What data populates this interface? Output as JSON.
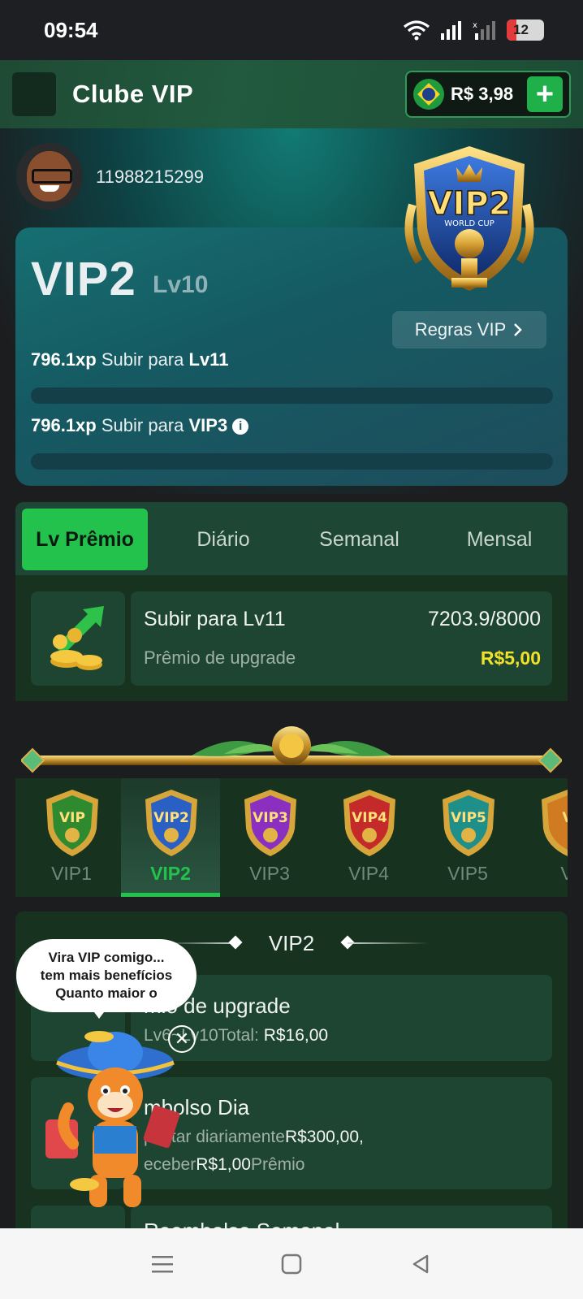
{
  "status": {
    "time": "09:54",
    "battery_level": "12"
  },
  "header": {
    "title": "Clube VIP",
    "balance": "R$ 3,98",
    "add_label": "+"
  },
  "user": {
    "id": "11988215299"
  },
  "vip_card": {
    "level": "VIP2",
    "sub_level": "Lv10",
    "badge_text": "VIP2",
    "badge_subtext": "WORLD CUP",
    "rules_label": "Regras VIP",
    "xp_lv_value": "796.1xp",
    "xp_lv_text": "Subir para",
    "xp_lv_target": "Lv11",
    "xp_vip_value": "796.1xp",
    "xp_vip_text": "Subir para",
    "xp_vip_target": "VIP3",
    "progress_lv": 0,
    "progress_vip": 0
  },
  "tabs": [
    {
      "label": "Lv Prêmio",
      "active": true
    },
    {
      "label": "Diário",
      "active": false
    },
    {
      "label": "Semanal",
      "active": false
    },
    {
      "label": "Mensal",
      "active": false
    }
  ],
  "level_reward": {
    "title": "Subir para Lv11",
    "progress": "7203.9/8000",
    "subtitle": "Prêmio de upgrade",
    "value": "R$5,00"
  },
  "levels": [
    {
      "label": "VIP1",
      "badge": "VIP",
      "color": "#2f8a2f"
    },
    {
      "label": "VIP2",
      "badge": "VIP2",
      "color": "#2a5fc4",
      "active": true
    },
    {
      "label": "VIP3",
      "badge": "VIP3",
      "color": "#8a2fc0"
    },
    {
      "label": "VIP4",
      "badge": "VIP4",
      "color": "#c42a2a"
    },
    {
      "label": "VIP5",
      "badge": "VIP5",
      "color": "#1f8f8a"
    },
    {
      "label": "V",
      "badge": "V",
      "color": "#d07a22"
    }
  ],
  "benefits": {
    "title": "VIP2",
    "items": [
      {
        "title": "mio de upgrade",
        "line1_prefix": "Lv6~Lv10Total: ",
        "line1_value": "R$16,00"
      },
      {
        "title": "mbolso Dia",
        "line1_prefix": "postar diariamente",
        "line1_value": "R$300,00,",
        "line2_prefix": "eceber",
        "line2_value": "R$1,00",
        "line2_suffix": "Prêmio"
      },
      {
        "title": "Reembolso Semanal"
      }
    ]
  },
  "bubble": {
    "line1": "Vira VIP comigo...",
    "line2": "tem mais benefícios",
    "line3": "Quanto maior o"
  },
  "close_symbol": "✕"
}
